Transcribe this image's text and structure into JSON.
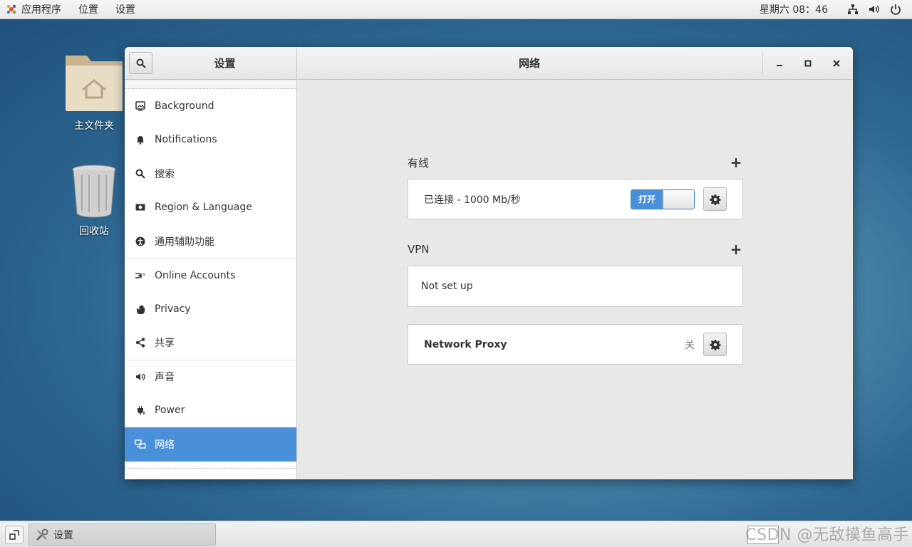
{
  "topbar": {
    "apps_label": "应用程序",
    "places_label": "位置",
    "settings_label": "设置",
    "clock": "星期六 08：46"
  },
  "desktop": {
    "home_label": "主文件夹",
    "trash_label": "回收站"
  },
  "window": {
    "sidebar_title": "设置",
    "panel_title": "网络"
  },
  "sidebar": {
    "items": [
      {
        "label": "Background",
        "icon": "background-icon"
      },
      {
        "label": "Notifications",
        "icon": "bell-icon"
      },
      {
        "label": "搜索",
        "icon": "search-icon"
      },
      {
        "label": "Region & Language",
        "icon": "region-icon"
      },
      {
        "label": "通用辅助功能",
        "icon": "accessibility-icon"
      },
      {
        "label": "Online Accounts",
        "icon": "online-accounts-icon"
      },
      {
        "label": "Privacy",
        "icon": "hand-icon"
      },
      {
        "label": "共享",
        "icon": "share-icon"
      },
      {
        "label": "声音",
        "icon": "speaker-icon"
      },
      {
        "label": "Power",
        "icon": "power-plug-icon"
      },
      {
        "label": "网络",
        "icon": "network-icon",
        "selected": true
      }
    ]
  },
  "network": {
    "wired": {
      "header": "有线",
      "status": "已连接 - 1000 Mb/秒",
      "switch_label": "打开",
      "switch_on": true
    },
    "vpn": {
      "header": "VPN",
      "status": "Not set up"
    },
    "proxy": {
      "label": "Network Proxy",
      "state": "关"
    }
  },
  "taskbar": {
    "task_label": "设置",
    "watermark": "CSDN @无敌摸鱼高手"
  },
  "colors": {
    "accent": "#4a90d9"
  }
}
